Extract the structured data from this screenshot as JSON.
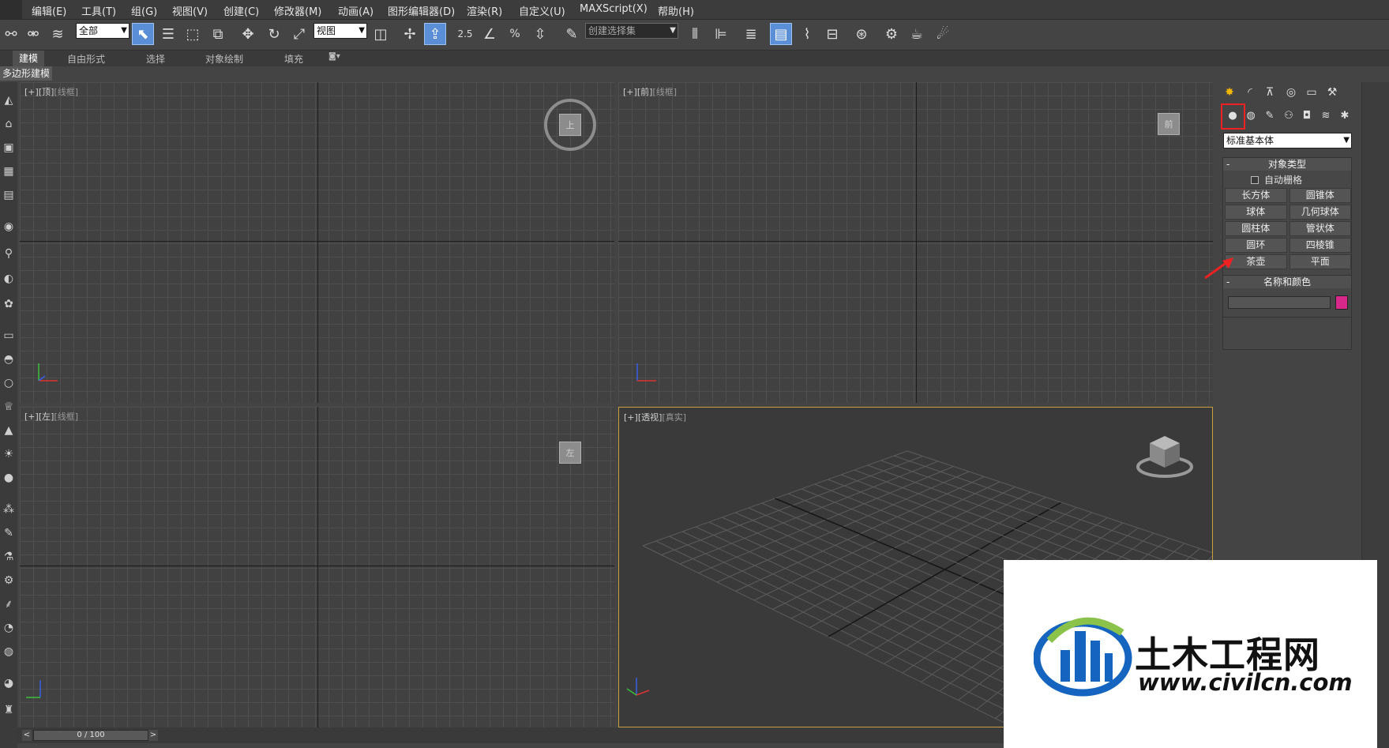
{
  "menubar": {
    "items": [
      "编辑(E)",
      "工具(T)",
      "组(G)",
      "视图(V)",
      "创建(C)",
      "修改器(M)",
      "动画(A)",
      "图形编辑器(D)",
      "渲染(R)",
      "自定义(U)",
      "MAXScript(X)",
      "帮助(H)"
    ]
  },
  "toolbar": {
    "selection_filter": "全部",
    "reference_coord": "视图",
    "snap_value": "2.5",
    "named_selection_placeholder": "创建选择集"
  },
  "ribbon": {
    "tabs": [
      "建模",
      "自由形式",
      "选择",
      "对象绘制",
      "填充"
    ],
    "subpanel": "多边形建模"
  },
  "viewports": {
    "top": {
      "label_a": "[+]",
      "label_b": "[顶]",
      "label_c": "[线框]",
      "cube": "上"
    },
    "front": {
      "label_a": "[+]",
      "label_b": "[前]",
      "label_c": "[线框]",
      "cube": "前"
    },
    "left": {
      "label_a": "[+]",
      "label_b": "[左]",
      "label_c": "[线框]",
      "cube": "左"
    },
    "perspective": {
      "label_a": "[+]",
      "label_b": "[透视]",
      "label_c": "[真实]"
    }
  },
  "command_panel": {
    "category_dropdown": "标准基本体",
    "object_type": {
      "title": "对象类型",
      "collapse": "-",
      "autogrid_label": "自动栅格",
      "buttons": [
        "长方体",
        "圆锥体",
        "球体",
        "几何球体",
        "圆柱体",
        "管状体",
        "圆环",
        "四棱锥",
        "茶壶",
        "平面"
      ]
    },
    "name_color": {
      "title": "名称和颜色",
      "collapse": "-",
      "name_value": "",
      "color": "#d8288a"
    }
  },
  "timeline": {
    "position": "0 / 100",
    "prev": "<",
    "next": ">"
  },
  "watermark": {
    "title": "土木工程网",
    "url": "www.civilcn.com"
  },
  "colors": {
    "highlight": "#e22222",
    "active_viewport_border": "#c8a040",
    "active_tool": "#5a8ed6"
  }
}
